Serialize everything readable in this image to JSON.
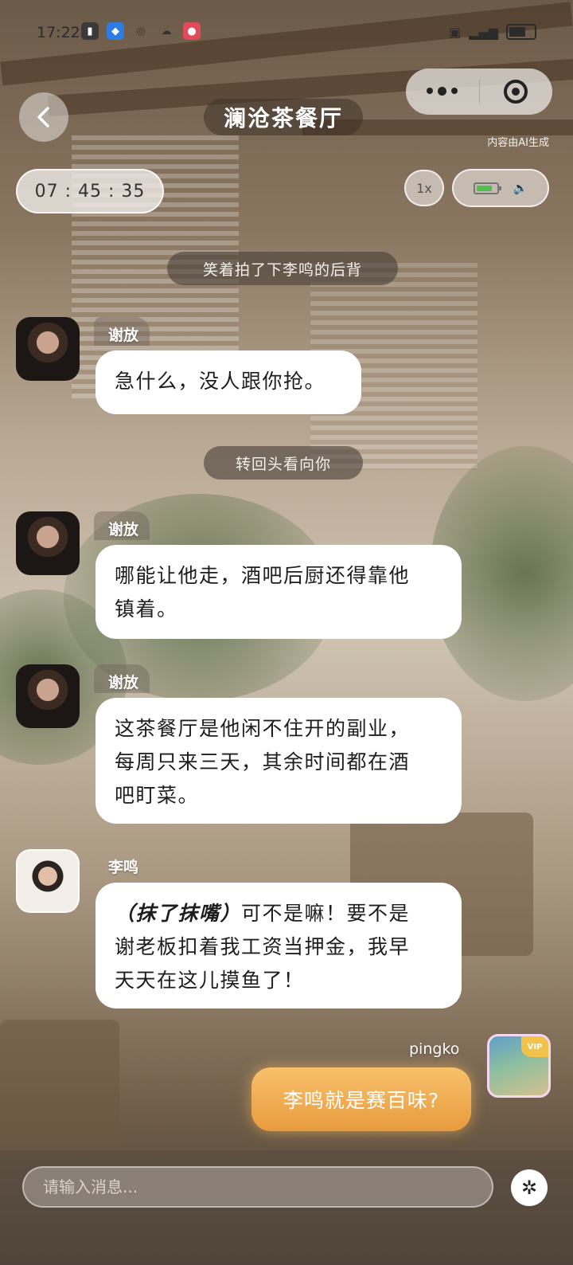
{
  "status_bar": {
    "time": "17:22"
  },
  "header": {
    "title": "澜沧茶餐厅",
    "ai_note": "内容由AI生成"
  },
  "timer": {
    "value": "07 : 45 : 35"
  },
  "controls": {
    "speed": "1x"
  },
  "narrations": [
    {
      "text": "笑着拍了下李鸣的后背"
    },
    {
      "text": "转回头看向你"
    }
  ],
  "messages": [
    {
      "speaker": "谢放",
      "text": "急什么，没人跟你抢。"
    },
    {
      "speaker": "谢放",
      "text_line1": "哪能让他走，酒吧后厨还得靠他",
      "text_line2": "镇着。"
    },
    {
      "speaker": "谢放",
      "text_line1": "这茶餐厅是他闲不住开的副业，",
      "text_line2": "每周只来三天，其余时间都在酒",
      "text_line3": "吧盯菜。"
    },
    {
      "speaker": "李鸣",
      "action": "（抹了抹嘴）",
      "text_line1_rest": "可不是嘛！要不是",
      "text_line2": "谢老板扣着我工资当押金，我早",
      "text_line3": "天天在这儿摸鱼了！"
    }
  ],
  "user_message": {
    "speaker": "pingko",
    "text": "李鸣就是赛百味?",
    "badge": "VIP"
  },
  "input": {
    "placeholder": "请输入消息..."
  },
  "colors": {
    "accent": "#e89b3e",
    "bubble": "#ffffff",
    "battery": "#4ec04e"
  },
  "icons": {
    "back": "chevron-left-icon",
    "more": "more-dots-icon",
    "target": "target-icon",
    "battery": "battery-icon",
    "sound": "speaker-icon",
    "action": "character-action-icon"
  }
}
